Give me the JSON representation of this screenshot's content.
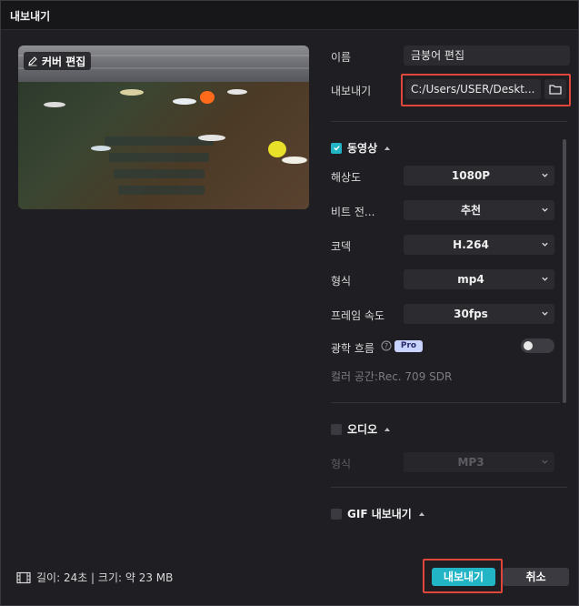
{
  "window": {
    "title": "내보내기"
  },
  "preview": {
    "cover_edit_label": "커버 편집"
  },
  "name": {
    "label": "이름",
    "value": "금붕어 편집"
  },
  "export_path": {
    "label": "내보내기",
    "value": "C:/Users/USER/Deskt..."
  },
  "video": {
    "title": "동영상",
    "checked": true,
    "resolution": {
      "label": "해상도",
      "value": "1080P"
    },
    "bitrate": {
      "label": "비트 전...",
      "value": "추천"
    },
    "codec": {
      "label": "코덱",
      "value": "H.264"
    },
    "format": {
      "label": "형식",
      "value": "mp4"
    },
    "framerate": {
      "label": "프레임 속도",
      "value": "30fps"
    },
    "optical_flow": {
      "label": "광학 흐름",
      "badge": "Pro",
      "enabled": false
    },
    "color_space": "컬러 공간:Rec. 709 SDR"
  },
  "audio": {
    "title": "오디오",
    "checked": false,
    "format": {
      "label": "형식",
      "value": "MP3"
    }
  },
  "gif": {
    "title": "GIF 내보내기",
    "checked": false
  },
  "footer": {
    "info": "길이: 24초 | 크기: 약 23 MB",
    "export_button": "내보내기",
    "cancel_button": "취소"
  },
  "colors": {
    "accent": "#21b5c6",
    "highlight": "#e0463a",
    "background": "#1f1f23",
    "field": "#2b2b30"
  }
}
